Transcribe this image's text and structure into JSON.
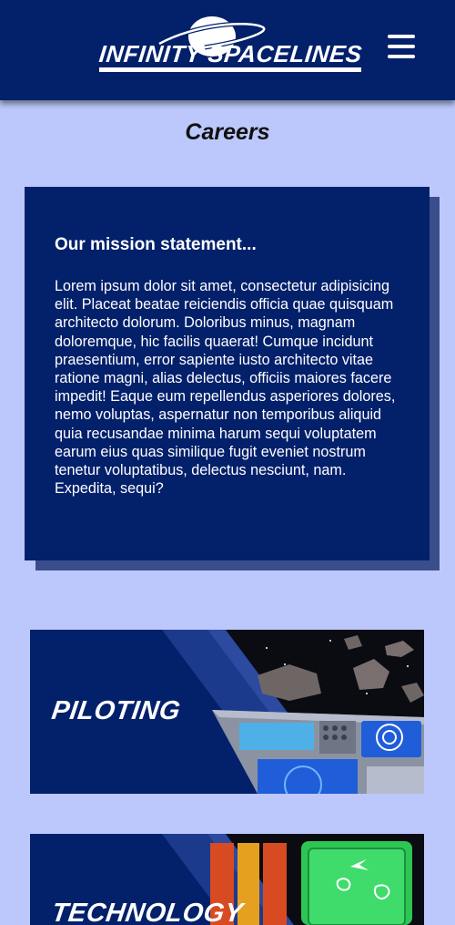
{
  "header": {
    "logo_text": "INFINITY SPACELINES",
    "menu_icon": "hamburger-menu-icon"
  },
  "page": {
    "title": "Careers"
  },
  "mission": {
    "title": "Our mission statement...",
    "body": "Lorem ipsum dolor sit amet, consectetur adipisicing elit. Placeat beatae reiciendis officia quae quisquam architecto dolorum. Doloribus minus, magnam doloremque, hic facilis quaerat! Cumque incidunt praesentium, error sapiente iusto architecto vitae ratione magni, alias delectus, officiis maiores facere impedit! Eaque eum repellendus asperiores dolores, nemo voluptas, aspernatur non temporibus aliquid quia recusandae minima harum sequi voluptatem earum eius quas similique fugit eveniet nostrum tenetur voluptatibus, delectus nesciunt, nam. Expedita, sequi?"
  },
  "careers": [
    {
      "label": "PILOTING"
    },
    {
      "label": "TECHNOLOGY"
    }
  ],
  "colors": {
    "header_bg": "#03206b",
    "page_bg": "#bcc8fb",
    "card_bg": "#03206b",
    "card_shadow": "#3a4e8c",
    "text_light": "#ffffff"
  }
}
